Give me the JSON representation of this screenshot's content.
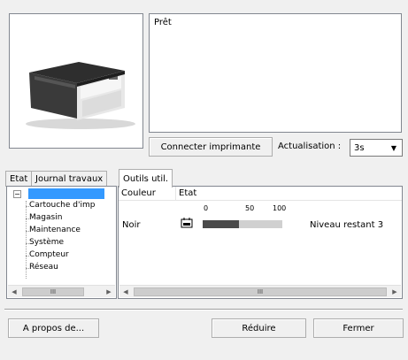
{
  "status": {
    "text": "Prêt"
  },
  "printer_image": {
    "icon": "printer-icon"
  },
  "toolbar": {
    "connect_label": "Connecter imprimante",
    "refresh_label": "Actualisation :",
    "refresh_value": "3s"
  },
  "tabs": [
    {
      "label": "Etat",
      "active": false
    },
    {
      "label": "Journal travaux",
      "active": false
    },
    {
      "label": "Outils util.",
      "active": true
    }
  ],
  "tree": {
    "root_label": "",
    "items": [
      {
        "label": "Cartouche d'imp"
      },
      {
        "label": "Magasin"
      },
      {
        "label": "Maintenance"
      },
      {
        "label": "Système"
      },
      {
        "label": "Compteur"
      },
      {
        "label": "Réseau"
      }
    ],
    "scroll_thumb": "III"
  },
  "toner": {
    "headers": {
      "color": "Couleur",
      "state": "Etat"
    },
    "scale": [
      "0",
      "50",
      "100"
    ],
    "row": {
      "color": "Noir",
      "level_text": "Niveau restant 3",
      "level_fraction": 0.45
    },
    "scroll_thumb": "III"
  },
  "footer": {
    "about_label": "A propos de...",
    "reduce_label": "Réduire",
    "close_label": "Fermer"
  },
  "colors": {
    "selection": "#3399ff",
    "bar_fill": "#4a4a4a",
    "bar_empty": "#d0d0d0"
  }
}
